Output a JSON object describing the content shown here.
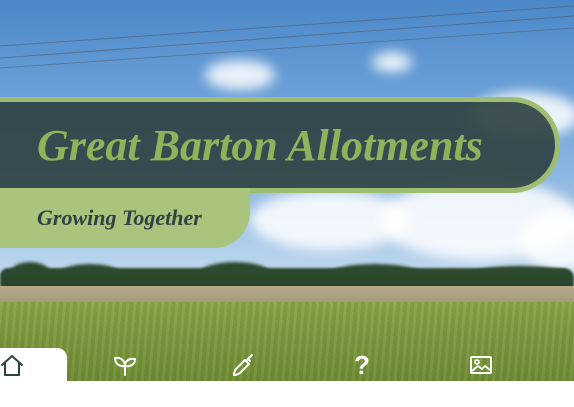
{
  "header": {
    "title": "Great Barton Allotments",
    "tagline": "Growing Together"
  },
  "nav": {
    "items": [
      {
        "icon": "home-icon",
        "active": true
      },
      {
        "icon": "seedling-icon",
        "active": false
      },
      {
        "icon": "trowel-icon",
        "active": false
      },
      {
        "icon": "help-icon",
        "glyph": "?",
        "active": false
      },
      {
        "icon": "gallery-icon",
        "active": false
      }
    ]
  },
  "colors": {
    "banner_bg": "#2f4242",
    "banner_border": "#9fbd71",
    "title_text": "#8fb35a",
    "tagline_bg": "#a8c47d",
    "tagline_text": "#2f4242",
    "nav_icon": "#ffffff",
    "nav_active_bg": "#ffffff",
    "nav_active_icon": "#2f4242"
  }
}
